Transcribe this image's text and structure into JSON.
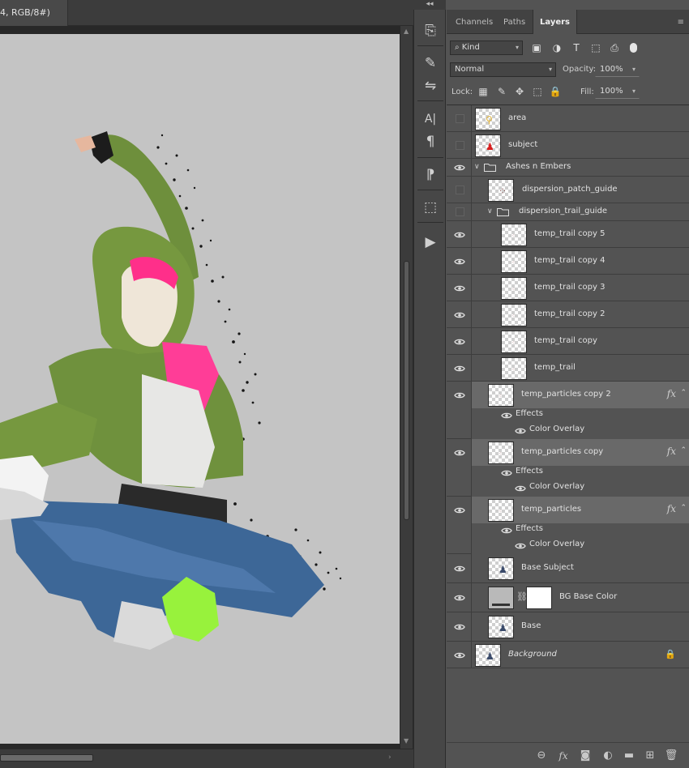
{
  "document": {
    "tab_title": "4, RGB/8#)"
  },
  "panel_collapse_glyph": "◂◂",
  "tool_strip": [
    {
      "name": "history-icon",
      "glyph": "⎘"
    },
    {
      "name": "brush-presets-icon",
      "glyph": "✎"
    },
    {
      "name": "adjustments-icon",
      "glyph": "⇋"
    },
    {
      "name": "character-icon",
      "glyph": "A|"
    },
    {
      "name": "paragraph-icon",
      "glyph": "¶"
    },
    {
      "name": "glyphs-icon",
      "glyph": "⁋"
    },
    {
      "name": "3d-icon",
      "glyph": "⬚"
    },
    {
      "name": "actions-play-icon",
      "glyph": "▶"
    }
  ],
  "panel": {
    "tabs": [
      "Channels",
      "Paths",
      "Layers"
    ],
    "active_tab": "Layers",
    "filter_kind": "Kind",
    "blend_mode": "Normal",
    "opacity_label": "Opacity:",
    "opacity_value": "100%",
    "lock_label": "Lock:",
    "fill_label": "Fill:",
    "fill_value": "100%"
  },
  "layers": [
    {
      "name": "area",
      "visible": false,
      "thumb_mark": "⚲",
      "mark_color": "#e0b33c"
    },
    {
      "name": "subject",
      "visible": false,
      "thumb_mark": "♟",
      "mark_color": "#d81e1e"
    },
    {
      "name": "Ashes n Embers",
      "visible": true,
      "group": true,
      "expanded": true
    },
    {
      "name": "dispersion_patch_guide",
      "visible": false,
      "thumb_mark": "⁘",
      "mark_color": "#8a5a5a"
    },
    {
      "name": "dispersion_trail_guide",
      "visible": false,
      "group": true,
      "expanded": true
    },
    {
      "name": "temp_trail copy 5",
      "visible": true
    },
    {
      "name": "temp_trail copy 4",
      "visible": true
    },
    {
      "name": "temp_trail copy 3",
      "visible": true
    },
    {
      "name": "temp_trail copy 2",
      "visible": true
    },
    {
      "name": "temp_trail copy",
      "visible": true
    },
    {
      "name": "temp_trail",
      "visible": true
    },
    {
      "name": "temp_particles copy 2",
      "visible": true,
      "fx": true,
      "effects": [
        "Effects",
        "Color Overlay"
      ]
    },
    {
      "name": "temp_particles copy",
      "visible": true,
      "fx": true,
      "effects": [
        "Effects",
        "Color Overlay"
      ]
    },
    {
      "name": "temp_particles",
      "visible": true,
      "fx": true,
      "effects": [
        "Effects",
        "Color Overlay"
      ]
    },
    {
      "name": "Base Subject",
      "visible": true,
      "thumb_mark": "♟",
      "mark_color": "#3a4a6a"
    },
    {
      "name": "BG Base Color",
      "visible": true,
      "mask": true
    },
    {
      "name": "Base",
      "visible": true,
      "thumb_mark": "♟",
      "mark_color": "#3a4a6a"
    },
    {
      "name": "Background",
      "visible": true,
      "locked": true,
      "italic": true,
      "thumb_mark": "♟",
      "mark_color": "#3a4a6a"
    }
  ],
  "fx_label": "fx",
  "footer_buttons": [
    {
      "name": "link-layers-icon",
      "glyph": "⊖"
    },
    {
      "name": "add-style-icon",
      "glyph": "fx"
    },
    {
      "name": "add-mask-icon",
      "glyph": "◙"
    },
    {
      "name": "adjustment-layer-icon",
      "glyph": "◐"
    },
    {
      "name": "new-group-icon",
      "glyph": "▬"
    },
    {
      "name": "new-layer-icon",
      "glyph": "⊞"
    },
    {
      "name": "delete-layer-icon",
      "glyph": "🗑"
    }
  ],
  "colors": {
    "canvas_bg": "#c4c4c4",
    "panel_bg": "#535353",
    "selected_row": "#696969"
  }
}
